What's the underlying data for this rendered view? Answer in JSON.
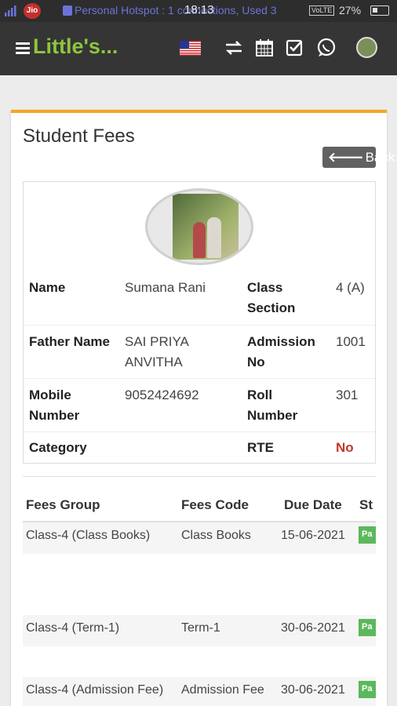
{
  "status_bar": {
    "carrier": "Jio",
    "notification": "Personal Hotspot : 1 connections, Used 3",
    "time": "18:13",
    "network": "VoLTE",
    "battery": "27%"
  },
  "app": {
    "title": "Little's..."
  },
  "page": {
    "title": "Student Fees",
    "back_label": "Back"
  },
  "student": {
    "fields": {
      "name_label": "Name",
      "name": "Sumana Rani",
      "class_label_1": "Class",
      "class_label_2": "Section",
      "class_section": "4 (A)",
      "father_label": "Father Name",
      "father_line1": "SAI PRIYA",
      "father_line2": "ANVITHA",
      "admission_label_1": "Admission",
      "admission_label_2": "No",
      "admission_no": "1001",
      "mobile_label_1": "Mobile",
      "mobile_label_2": "Number",
      "mobile": "9052424692",
      "roll_label_1": "Roll",
      "roll_label_2": "Number",
      "roll": "301",
      "category_label": "Category",
      "rte_label": "RTE",
      "rte": "No"
    }
  },
  "fees": {
    "columns": [
      "Fees Group",
      "Fees Code",
      "Due Date",
      "St"
    ],
    "rows": [
      {
        "group": "Class-4 (Class Books)",
        "code": "Class Books",
        "due": "15-06-2021",
        "status": "Pa"
      },
      {
        "group": "Class-4 (Term-1)",
        "code": "Term-1",
        "due": "30-06-2021",
        "status": "Pa"
      },
      {
        "group": "Class-4 (Admission Fee)",
        "code": "Admission Fee",
        "due": "30-06-2021",
        "status": "Pa"
      }
    ]
  },
  "colors": {
    "brand": "#8ec63f",
    "accent": "#f5a623",
    "paid": "#5cb85c",
    "rte_no": "#c0392b"
  }
}
